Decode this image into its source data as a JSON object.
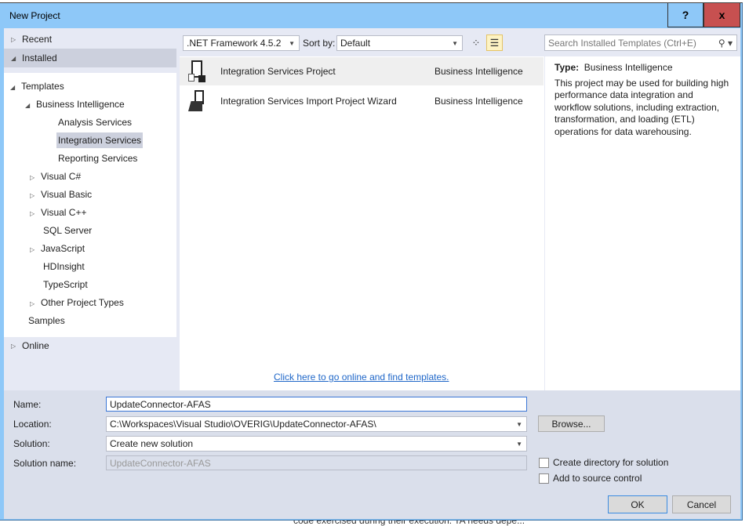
{
  "window": {
    "title": "New Project",
    "help_label": "?",
    "close_label": "x"
  },
  "left": {
    "recent": "Recent",
    "installed": "Installed",
    "online": "Online",
    "tree": [
      {
        "label": "Templates"
      },
      {
        "label": "Business Intelligence"
      },
      {
        "label": "Analysis Services"
      },
      {
        "label": "Integration Services",
        "selected": true
      },
      {
        "label": "Reporting Services"
      },
      {
        "label": "Visual C#"
      },
      {
        "label": "Visual Basic"
      },
      {
        "label": "Visual C++"
      },
      {
        "label": "SQL Server"
      },
      {
        "label": "JavaScript"
      },
      {
        "label": "HDInsight"
      },
      {
        "label": "TypeScript"
      },
      {
        "label": "Other Project Types"
      },
      {
        "label": "Samples"
      }
    ]
  },
  "toolbar": {
    "framework": ".NET Framework 4.5.2",
    "sort_label": "Sort by:",
    "sort_value": "Default",
    "search_placeholder": "Search Installed Templates (Ctrl+E)"
  },
  "templates": [
    {
      "name": "Integration Services Project",
      "category": "Business Intelligence",
      "selected": true
    },
    {
      "name": "Integration Services Import Project Wizard",
      "category": "Business Intelligence"
    }
  ],
  "online_link": "Click here to go online and find templates.",
  "description": {
    "type_label": "Type:",
    "type_value": "Business Intelligence",
    "text": "This project may be used for building high performance data integration and workflow solutions, including extraction, transformation, and loading (ETL) operations for data warehousing."
  },
  "form": {
    "name_label": "Name:",
    "name_value": "UpdateConnector-AFAS",
    "location_label": "Location:",
    "location_value": "C:\\Workspaces\\Visual Studio\\OVERIG\\UpdateConnector-AFAS\\",
    "browse": "Browse...",
    "solution_label": "Solution:",
    "solution_value": "Create new solution",
    "solution_name_label": "Solution name:",
    "solution_name_value": "UpdateConnector-AFAS",
    "create_dir": "Create directory for solution",
    "source_control": "Add to source control",
    "ok": "OK",
    "cancel": "Cancel"
  },
  "background": {
    "snippet": "code exercised during their execution. TA needs depe..."
  }
}
